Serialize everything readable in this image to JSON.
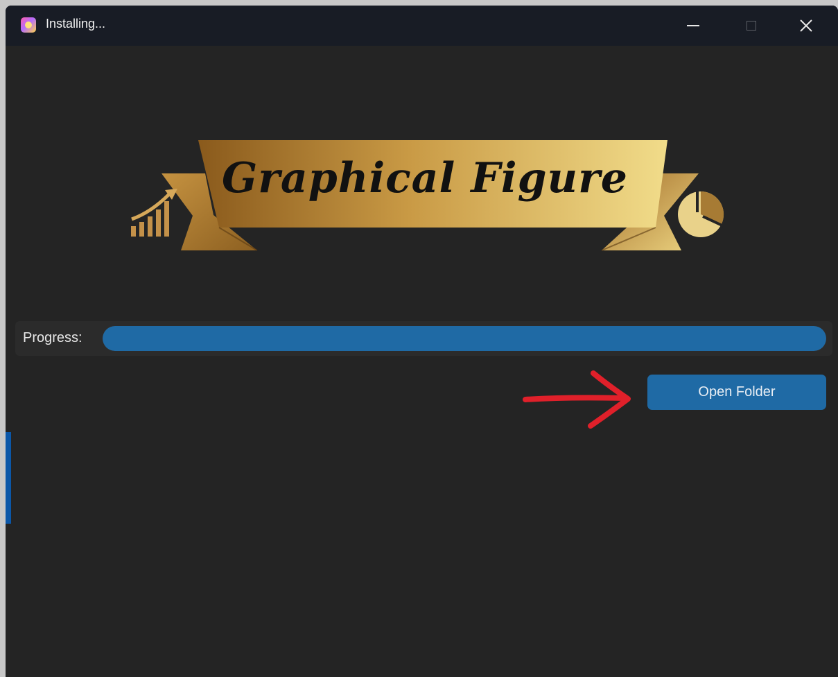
{
  "window": {
    "title": "Installing...",
    "icon": "app-icon",
    "controls": {
      "minimize_icon": "minimize-icon",
      "maximize_icon": "maximize-icon",
      "close_glyph": "✕"
    }
  },
  "logo": {
    "text": "Graphical Figure",
    "left_icon": "growth-chart-icon",
    "right_icon": "pie-chart-icon",
    "colors": {
      "gold_dark": "#8a5a1c",
      "gold_light": "#f1dc8a"
    }
  },
  "progress": {
    "label": "Progress:",
    "value_fraction": 1.0,
    "fill_color": "#1f6aa5"
  },
  "actions": {
    "open_folder_label": "Open Folder"
  },
  "annotation": {
    "arrow_color": "#e0202a",
    "arrow_icon": "red-arrow-annotation"
  },
  "colors": {
    "window_bg": "#242424",
    "titlebar_bg": "#181c25",
    "accent": "#1f6aa5"
  }
}
